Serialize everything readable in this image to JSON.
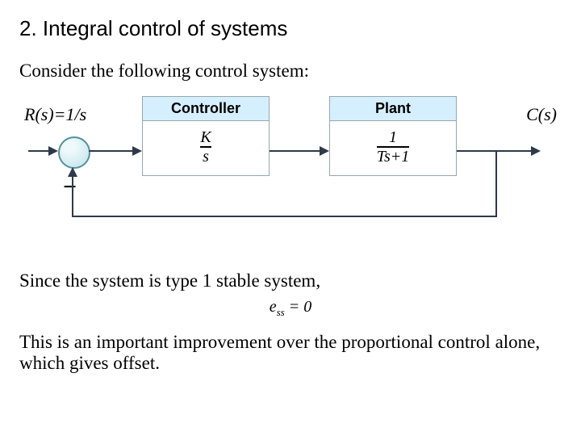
{
  "title": "2. Integral control of systems",
  "intro": "Consider the following control system:",
  "input_label": "R(s)=1/s",
  "output_label": "C(s)",
  "minus": "−",
  "controller": {
    "title": "Controller",
    "num": "K",
    "den": "s"
  },
  "plant": {
    "title": "Plant",
    "num": "1",
    "den": "Ts+1"
  },
  "type_line": "Since the system is type 1 stable system,",
  "ess_html": "e_ss = 0",
  "ess": {
    "sym": "e",
    "sub": "ss",
    "eq": " = 0"
  },
  "conclusion": "This is an important improvement over the proportional control alone, which gives offset."
}
